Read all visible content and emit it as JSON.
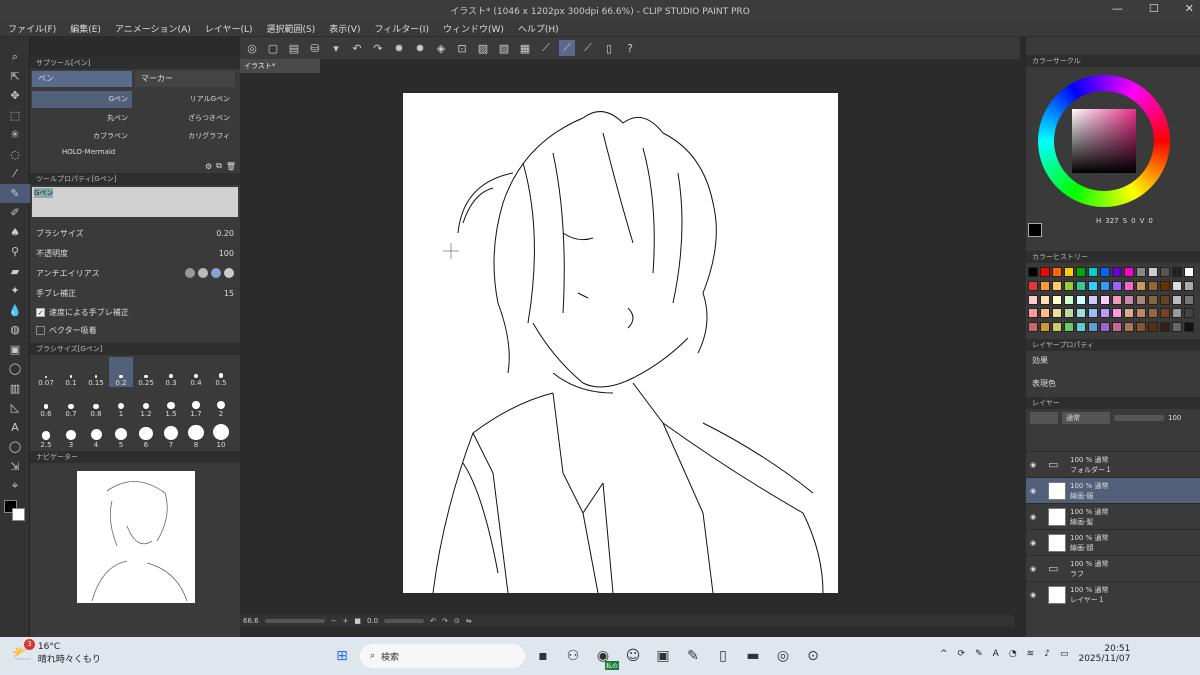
{
  "window": {
    "title": "イラスト* (1046 x 1202px 300dpi 66.6%)  - CLIP STUDIO PAINT PRO"
  },
  "menu": [
    "ファイル(F)",
    "編集(E)",
    "アニメーション(A)",
    "レイヤー(L)",
    "選択範囲(S)",
    "表示(V)",
    "フィルター(I)",
    "ウィンドウ(W)",
    "ヘルプ(H)"
  ],
  "doc_tab": "イラスト*",
  "subtool": {
    "header": "サブツール[ペン]",
    "tabs": [
      "ペン",
      "マーカー"
    ],
    "items": [
      "Gペン",
      "リアルGペン",
      "丸ペン",
      "ざらつきペン",
      "カブラペン",
      "カリグラフィ",
      "HOLO-Mermaid"
    ]
  },
  "toolprop": {
    "header": "ツールプロパティ[Gペン]",
    "tool_name": "Gペン",
    "brush_size_label": "ブラシサイズ",
    "brush_size": "0.20",
    "opacity_label": "不透明度",
    "opacity": "100",
    "antialias_label": "アンチエイリアス",
    "stabilization_label": "手ブレ補正",
    "stabilization": "15",
    "speed_stab_label": "速度による手ブレ補正",
    "vector_label": "ベクター吸着"
  },
  "brushsize": {
    "header": "ブラシサイズ[Gペン]",
    "sizes": [
      "0.07",
      "0.1",
      "0.15",
      "0.2",
      "0.25",
      "0.3",
      "0.4",
      "0.5",
      "0.6",
      "0.7",
      "0.8",
      "1",
      "1.2",
      "1.5",
      "1.7",
      "2",
      "2.5",
      "3",
      "4",
      "5",
      "6",
      "7",
      "8",
      "10"
    ],
    "selected": "0.2"
  },
  "navigator": {
    "header": "ナビゲーター"
  },
  "status": {
    "zoom": "66.6",
    "angle": "0.0"
  },
  "color_circle": {
    "header": "カラーサークル",
    "h": "327",
    "s": "0",
    "v": "0",
    "labels": [
      "H",
      "S",
      "V"
    ]
  },
  "color_history": {
    "header": "カラーヒストリー"
  },
  "layer_property": {
    "header": "レイヤープロパティ",
    "effect_label": "効果",
    "display_color_label": "表現色"
  },
  "layers": {
    "header": "レイヤー",
    "blend": "通常",
    "opacity": "100",
    "items": [
      {
        "mode": "100 % 通常",
        "name": "フォルダー１",
        "type": "folder"
      },
      {
        "mode": "100 % 通常",
        "name": "線画-服",
        "type": "layer",
        "selected": true
      },
      {
        "mode": "100 % 通常",
        "name": "線画-髪",
        "type": "layer"
      },
      {
        "mode": "100 % 通常",
        "name": "線画-顔",
        "type": "layer"
      },
      {
        "mode": "100 % 通常",
        "name": "ラフ",
        "type": "folder"
      },
      {
        "mode": "100 % 通常",
        "name": "レイヤー１",
        "type": "layer"
      }
    ]
  },
  "taskbar": {
    "weather_temp": "16°C",
    "weather_desc": "晴れ時々くもり",
    "weather_badge": "3",
    "search_placeholder": "検索",
    "time": "20:51",
    "date": "2025/11/07",
    "chrome_badge": "私の"
  },
  "colors": {
    "accent": "#52607a",
    "panel": "#3a3a3a",
    "canvas": "#2b2b2b"
  }
}
